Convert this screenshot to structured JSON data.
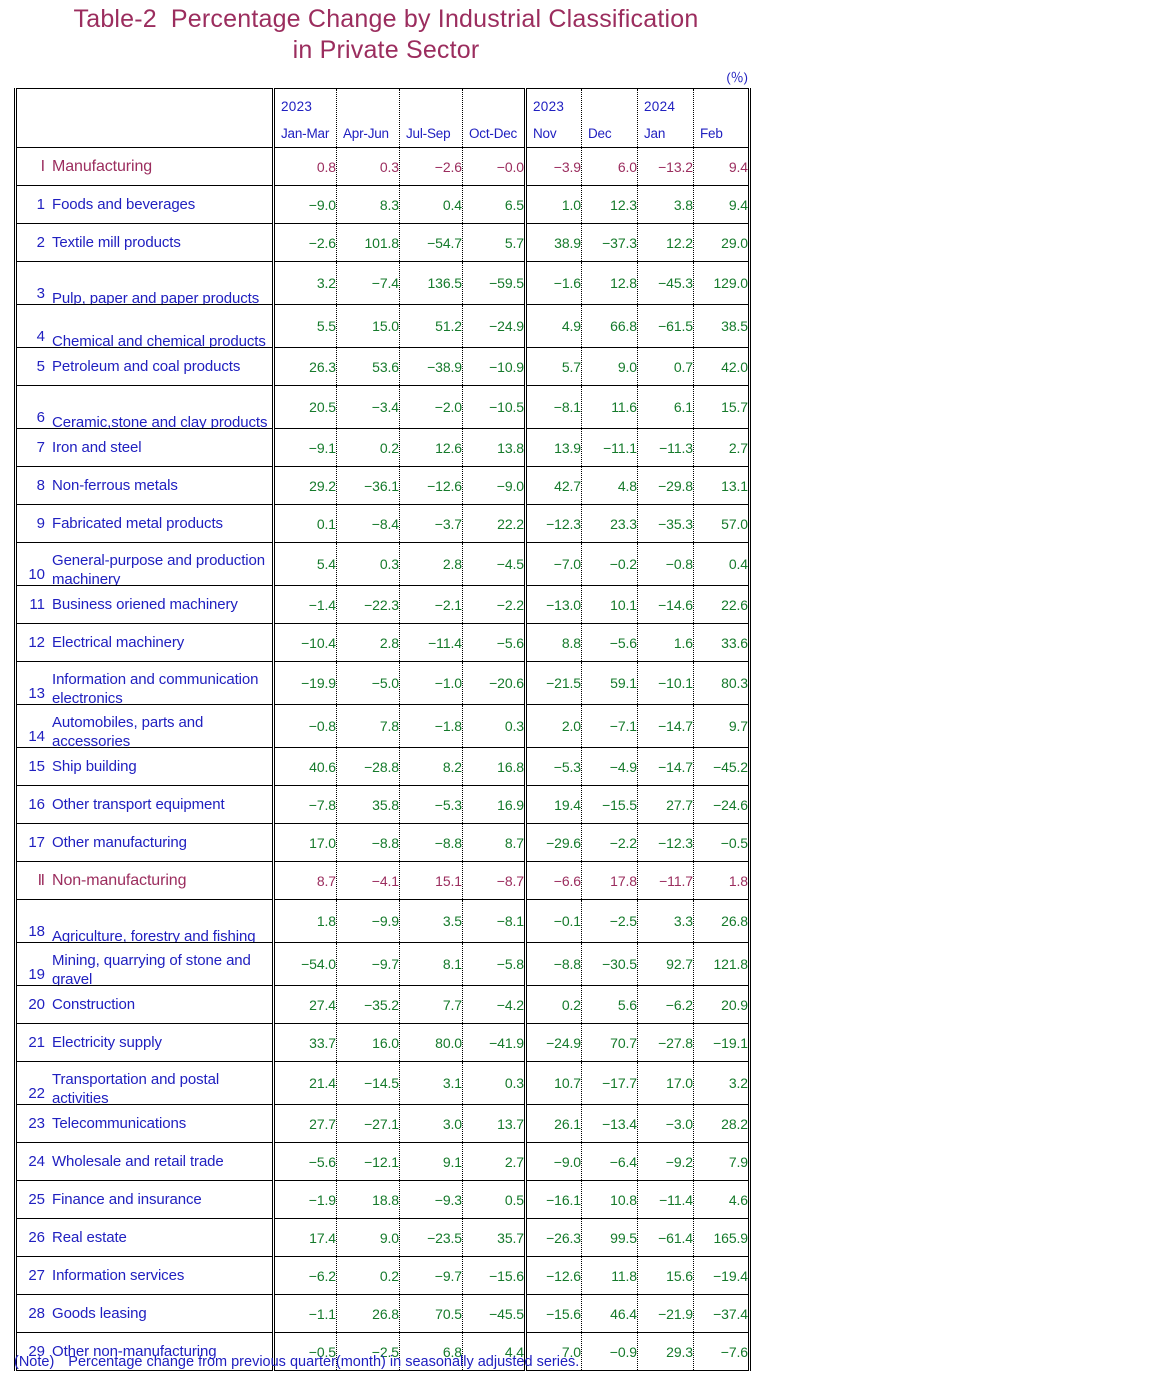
{
  "title": {
    "table_number": "Table-2",
    "line1": "Percentage Change by Industrial Classification",
    "line2": "in Private Sector"
  },
  "unit": "(％)",
  "colors": {
    "title": "#9b2d5e",
    "heading_row": "#9b2d5e",
    "label_text": "#2020c0",
    "value_text": "#157a2b",
    "note": "#2020c0"
  },
  "header": {
    "quarterly_year": "2023",
    "monthly_year_1": "2023",
    "monthly_year_2": "2024",
    "periods": [
      "Jan-Mar",
      "Apr-Jun",
      "Jul-Sep",
      "Oct-Dec",
      "Nov",
      "Dec",
      "Jan",
      "Feb"
    ]
  },
  "rows": [
    {
      "num": "Ⅰ",
      "label": "Manufacturing",
      "section": true,
      "lines": 1,
      "values": [
        "0.8",
        "0.3",
        "−2.6",
        "−0.0",
        "−3.9",
        "6.0",
        "−13.2",
        "9.4"
      ]
    },
    {
      "num": "1",
      "label": "Foods and beverages",
      "section": false,
      "lines": 1,
      "values": [
        "−9.0",
        "8.3",
        "0.4",
        "6.5",
        "1.0",
        "12.3",
        "3.8",
        "9.4"
      ]
    },
    {
      "num": "2",
      "label": "Textile mill products",
      "section": false,
      "lines": 1,
      "values": [
        "−2.6",
        "101.8",
        "−54.7",
        "5.7",
        "38.9",
        "−37.3",
        "12.2",
        "29.0"
      ]
    },
    {
      "num": "3",
      "label": "Pulp, paper and paper products",
      "section": false,
      "lines": 2,
      "values": [
        "3.2",
        "−7.4",
        "136.5",
        "−59.5",
        "−1.6",
        "12.8",
        "−45.3",
        "129.0"
      ]
    },
    {
      "num": "4",
      "label": "Chemical and chemical products",
      "section": false,
      "lines": 2,
      "values": [
        "5.5",
        "15.0",
        "51.2",
        "−24.9",
        "4.9",
        "66.8",
        "−61.5",
        "38.5"
      ]
    },
    {
      "num": "5",
      "label": "Petroleum and coal products",
      "section": false,
      "lines": 1,
      "values": [
        "26.3",
        "53.6",
        "−38.9",
        "−10.9",
        "5.7",
        "9.0",
        "0.7",
        "42.0"
      ]
    },
    {
      "num": "6",
      "label": "Ceramic,stone and clay products",
      "section": false,
      "lines": 2,
      "values": [
        "20.5",
        "−3.4",
        "−2.0",
        "−10.5",
        "−8.1",
        "11.6",
        "6.1",
        "15.7"
      ]
    },
    {
      "num": "7",
      "label": "Iron and steel",
      "section": false,
      "lines": 1,
      "values": [
        "−9.1",
        "0.2",
        "12.6",
        "13.8",
        "13.9",
        "−11.1",
        "−11.3",
        "2.7"
      ]
    },
    {
      "num": "8",
      "label": "Non-ferrous metals",
      "section": false,
      "lines": 1,
      "values": [
        "29.2",
        "−36.1",
        "−12.6",
        "−9.0",
        "42.7",
        "4.8",
        "−29.8",
        "13.1"
      ]
    },
    {
      "num": "9",
      "label": "Fabricated metal products",
      "section": false,
      "lines": 1,
      "values": [
        "0.1",
        "−8.4",
        "−3.7",
        "22.2",
        "−12.3",
        "23.3",
        "−35.3",
        "57.0"
      ]
    },
    {
      "num": "10",
      "label": "General-purpose and production machinery",
      "section": false,
      "lines": 2,
      "values": [
        "5.4",
        "0.3",
        "2.8",
        "−4.5",
        "−7.0",
        "−0.2",
        "−0.8",
        "0.4"
      ]
    },
    {
      "num": "11",
      "label": "Business oriened machinery",
      "section": false,
      "lines": 1,
      "values": [
        "−1.4",
        "−22.3",
        "−2.1",
        "−2.2",
        "−13.0",
        "10.1",
        "−14.6",
        "22.6"
      ]
    },
    {
      "num": "12",
      "label": "Electrical machinery",
      "section": false,
      "lines": 1,
      "values": [
        "−10.4",
        "2.8",
        "−11.4",
        "−5.6",
        "8.8",
        "−5.6",
        "1.6",
        "33.6"
      ]
    },
    {
      "num": "13",
      "label": "Information and communication electronics",
      "section": false,
      "lines": 2,
      "values": [
        "−19.9",
        "−5.0",
        "−1.0",
        "−20.6",
        "−21.5",
        "59.1",
        "−10.1",
        "80.3"
      ]
    },
    {
      "num": "14",
      "label": "Automobiles, parts and accessories",
      "section": false,
      "lines": 2,
      "values": [
        "−0.8",
        "7.8",
        "−1.8",
        "0.3",
        "2.0",
        "−7.1",
        "−14.7",
        "9.7"
      ]
    },
    {
      "num": "15",
      "label": "Ship building",
      "section": false,
      "lines": 1,
      "values": [
        "40.6",
        "−28.8",
        "8.2",
        "16.8",
        "−5.3",
        "−4.9",
        "−14.7",
        "−45.2"
      ]
    },
    {
      "num": "16",
      "label": "Other transport equipment",
      "section": false,
      "lines": 1,
      "values": [
        "−7.8",
        "35.8",
        "−5.3",
        "16.9",
        "19.4",
        "−15.5",
        "27.7",
        "−24.6"
      ]
    },
    {
      "num": "17",
      "label": "Other manufacturing",
      "section": false,
      "lines": 1,
      "values": [
        "17.0",
        "−8.8",
        "−8.8",
        "8.7",
        "−29.6",
        "−2.2",
        "−12.3",
        "−0.5"
      ]
    },
    {
      "num": "Ⅱ",
      "label": "Non-manufacturing",
      "section": true,
      "lines": 1,
      "values": [
        "8.7",
        "−4.1",
        "15.1",
        "−8.7",
        "−6.6",
        "17.8",
        "−11.7",
        "1.8"
      ]
    },
    {
      "num": "18",
      "label": "Agriculture, forestry and fishing",
      "section": false,
      "lines": 2,
      "values": [
        "1.8",
        "−9.9",
        "3.5",
        "−8.1",
        "−0.1",
        "−2.5",
        "3.3",
        "26.8"
      ]
    },
    {
      "num": "19",
      "label": "Mining, quarrying of stone and gravel",
      "section": false,
      "lines": 2,
      "values": [
        "−54.0",
        "−9.7",
        "8.1",
        "−5.8",
        "−8.8",
        "−30.5",
        "92.7",
        "121.8"
      ]
    },
    {
      "num": "20",
      "label": "Construction",
      "section": false,
      "lines": 1,
      "values": [
        "27.4",
        "−35.2",
        "7.7",
        "−4.2",
        "0.2",
        "5.6",
        "−6.2",
        "20.9"
      ]
    },
    {
      "num": "21",
      "label": "Electricity supply",
      "section": false,
      "lines": 1,
      "values": [
        "33.7",
        "16.0",
        "80.0",
        "−41.9",
        "−24.9",
        "70.7",
        "−27.8",
        "−19.1"
      ]
    },
    {
      "num": "22",
      "label": "Transportation and postal activities",
      "section": false,
      "lines": 2,
      "values": [
        "21.4",
        "−14.5",
        "3.1",
        "0.3",
        "10.7",
        "−17.7",
        "17.0",
        "3.2"
      ]
    },
    {
      "num": "23",
      "label": "Telecommunications",
      "section": false,
      "lines": 1,
      "values": [
        "27.7",
        "−27.1",
        "3.0",
        "13.7",
        "26.1",
        "−13.4",
        "−3.0",
        "28.2"
      ]
    },
    {
      "num": "24",
      "label": "Wholesale and retail trade",
      "section": false,
      "lines": 1,
      "values": [
        "−5.6",
        "−12.1",
        "9.1",
        "2.7",
        "−9.0",
        "−6.4",
        "−9.2",
        "7.9"
      ]
    },
    {
      "num": "25",
      "label": "Finance and insurance",
      "section": false,
      "lines": 1,
      "values": [
        "−1.9",
        "18.8",
        "−9.3",
        "0.5",
        "−16.1",
        "10.8",
        "−11.4",
        "4.6"
      ]
    },
    {
      "num": "26",
      "label": "Real estate",
      "section": false,
      "lines": 1,
      "values": [
        "17.4",
        "9.0",
        "−23.5",
        "35.7",
        "−26.3",
        "99.5",
        "−61.4",
        "165.9"
      ]
    },
    {
      "num": "27",
      "label": "Information services",
      "section": false,
      "lines": 1,
      "values": [
        "−6.2",
        "0.2",
        "−9.7",
        "−15.6",
        "−12.6",
        "11.8",
        "15.6",
        "−19.4"
      ]
    },
    {
      "num": "28",
      "label": "Goods leasing",
      "section": false,
      "lines": 1,
      "values": [
        "−1.1",
        "26.8",
        "70.5",
        "−45.5",
        "−15.6",
        "46.4",
        "−21.9",
        "−37.4"
      ]
    },
    {
      "num": "29",
      "label": "Other non-manufacturing",
      "section": false,
      "lines": 1,
      "values": [
        "−0.5",
        "−2.5",
        "6.8",
        "4.4",
        "7.0",
        "−0.9",
        "29.3",
        "−7.6"
      ]
    }
  ],
  "note": {
    "tag": "(Note)",
    "text": "Percentage change from previous quarter(month) in seasonally adjusted series."
  }
}
